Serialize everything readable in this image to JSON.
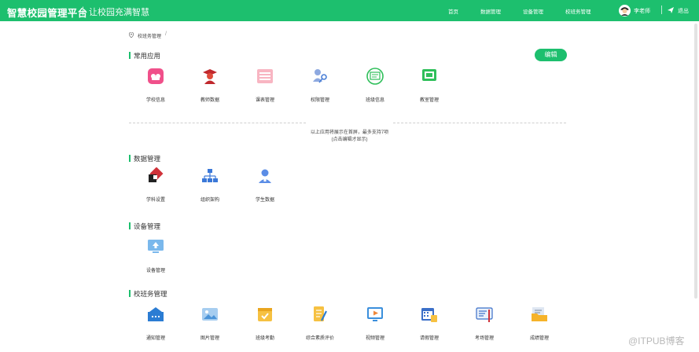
{
  "header": {
    "brand": "智慧校园管理平台",
    "separator": "|",
    "slogan": "让校园充满智慧",
    "nav": [
      "首页",
      "数据管理",
      "设备管理",
      "校班务管理"
    ],
    "user_name": "李老师",
    "logout": "退出",
    "bar_color": "#1dbf6e"
  },
  "breadcrumb": {
    "label": "校班务管理",
    "separator": "/"
  },
  "sections": {
    "common": {
      "title": "常用应用",
      "edit": "编辑",
      "apps": [
        "学校信息",
        "教师数据",
        "课表管理",
        "权限管理",
        "班级信息",
        "教室管理"
      ],
      "note_line1": "以上应用将展示在首屏，最多支持7项",
      "note_line2": "(点击编辑才显示)"
    },
    "data": {
      "title": "数据管理",
      "apps": [
        "学科设置",
        "组织架构",
        "学生数据"
      ]
    },
    "device": {
      "title": "设备管理",
      "apps": [
        "设备管理"
      ]
    },
    "campus": {
      "title": "校班务管理",
      "apps": [
        "通知管理",
        "图片管理",
        "班级考勤",
        "综合素质评价",
        "视频管理",
        "请假管理",
        "考场管理",
        "成绩管理"
      ]
    }
  },
  "watermark": "@ITPUB博客"
}
